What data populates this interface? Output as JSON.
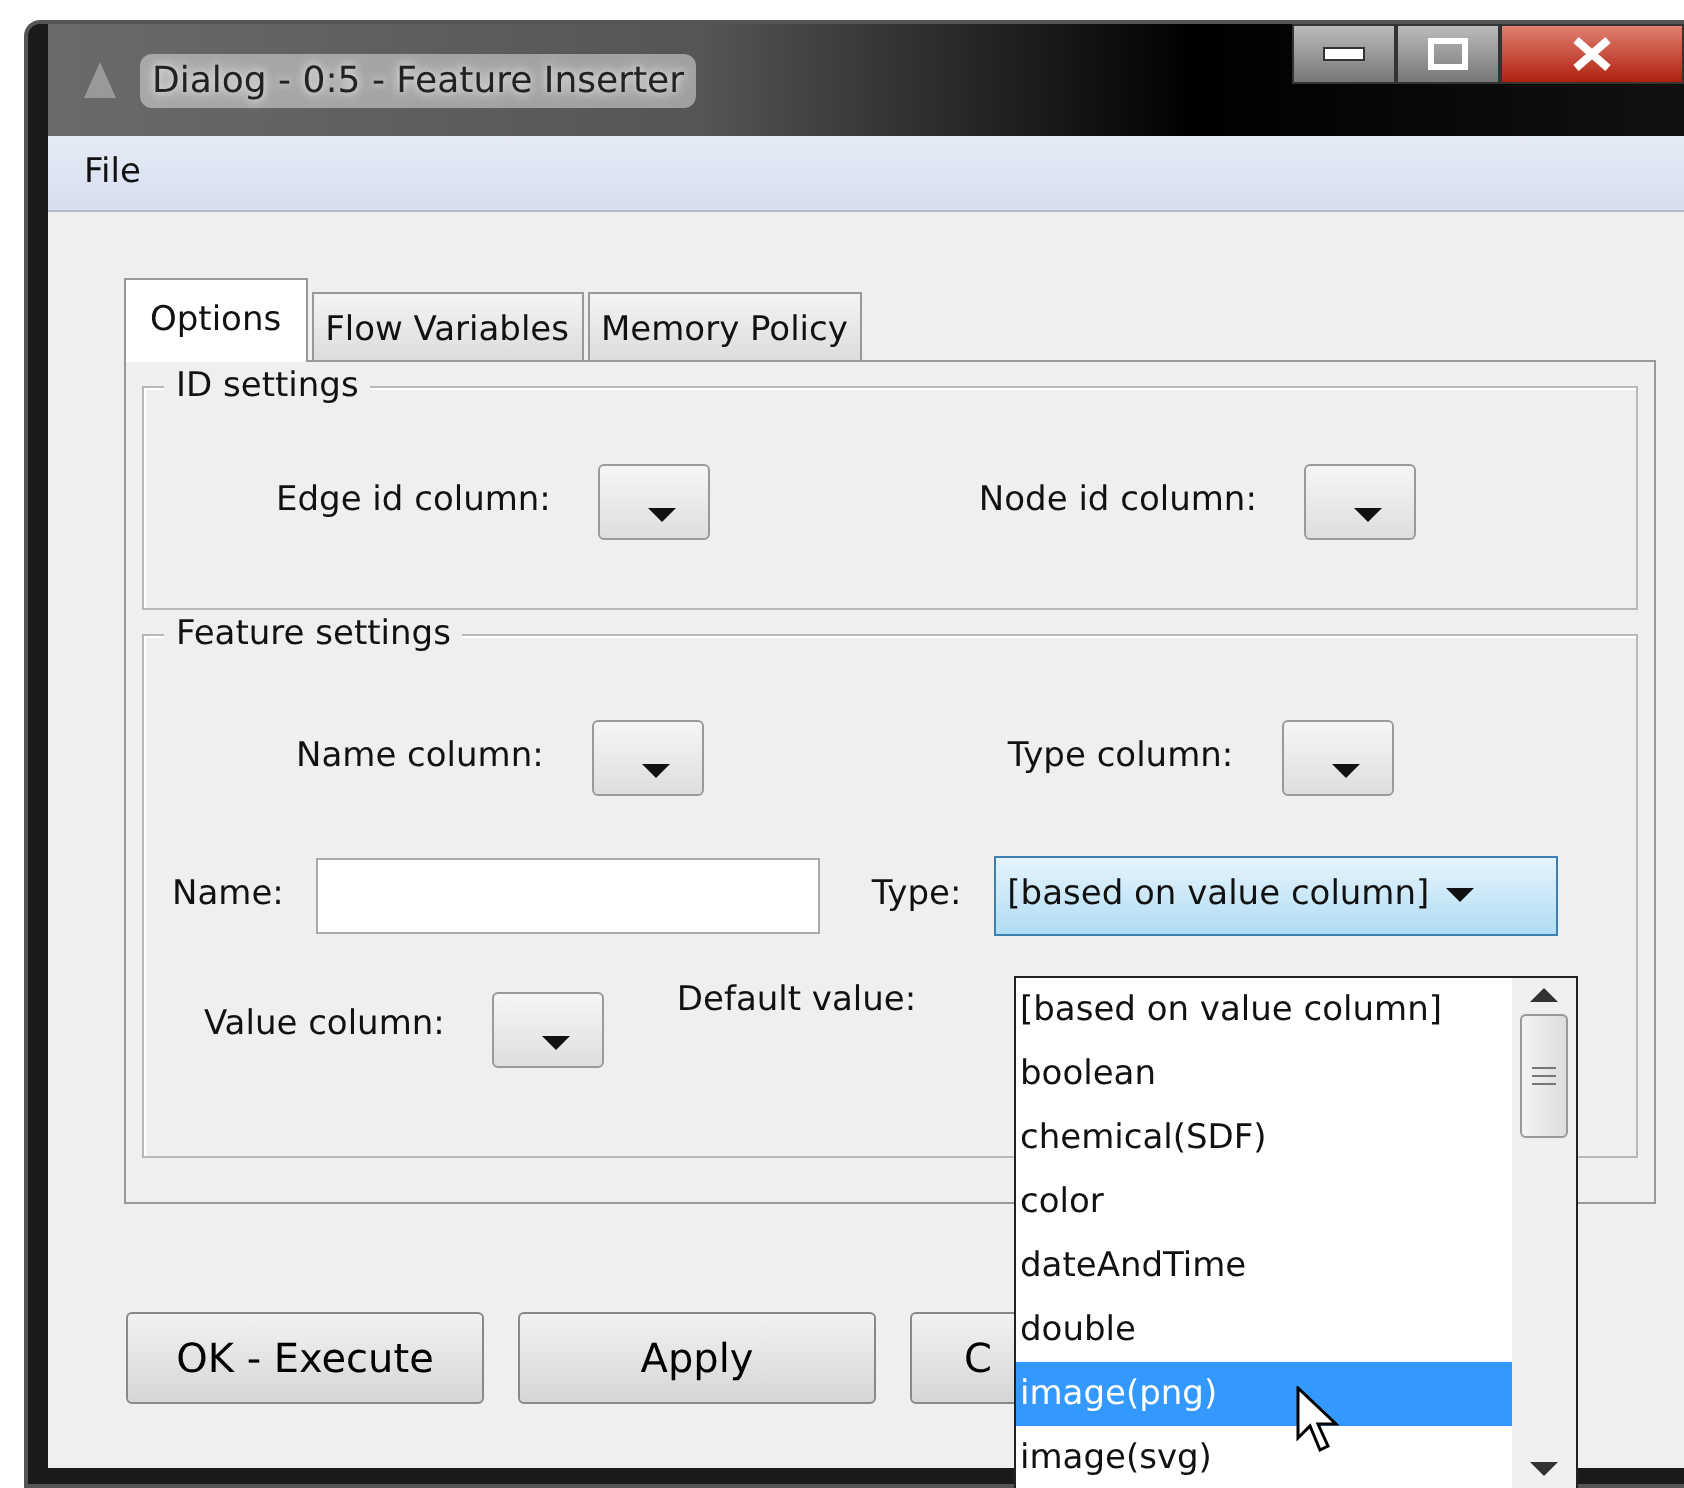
{
  "window": {
    "title": "Dialog - 0:5 - Feature Inserter"
  },
  "menu": [
    "File"
  ],
  "tabs": [
    {
      "label": "Options",
      "selected": true
    },
    {
      "label": "Flow Variables",
      "selected": false
    },
    {
      "label": "Memory Policy",
      "selected": false
    }
  ],
  "id_settings": {
    "title": "ID settings",
    "edge_label": "Edge id column:",
    "node_label": "Node id column:"
  },
  "feature_settings": {
    "title": "Feature settings",
    "name_column_label": "Name column:",
    "type_column_label": "Type column:",
    "name_label": "Name:",
    "type_label": "Type:",
    "type_value": "[based on value column]",
    "value_column_label": "Value column:",
    "default_value_label": "Default value:"
  },
  "type_options": [
    {
      "label": "[based on value column]",
      "selected": false
    },
    {
      "label": "boolean",
      "selected": false
    },
    {
      "label": "chemical(SDF)",
      "selected": false
    },
    {
      "label": "color",
      "selected": false
    },
    {
      "label": "dateAndTime",
      "selected": false
    },
    {
      "label": "double",
      "selected": false
    },
    {
      "label": "image(png)",
      "selected": true
    },
    {
      "label": "image(svg)",
      "selected": false
    }
  ],
  "buttons": [
    "OK - Execute",
    "Apply",
    "C"
  ]
}
